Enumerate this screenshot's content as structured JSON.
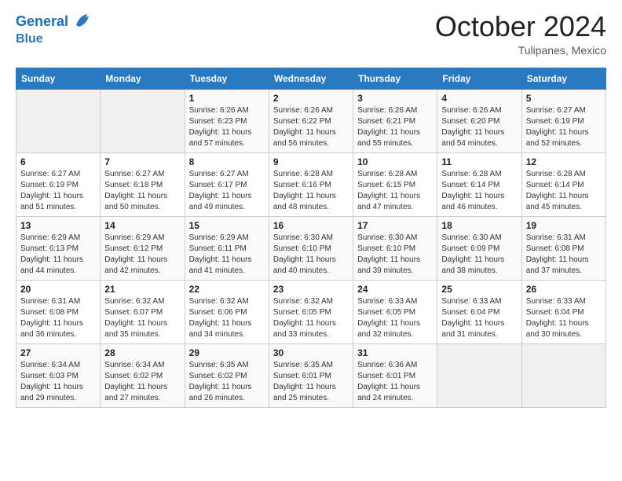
{
  "header": {
    "logo_line1": "General",
    "logo_line2": "Blue",
    "month_title": "October 2024",
    "location": "Tulipanes, Mexico"
  },
  "days_of_week": [
    "Sunday",
    "Monday",
    "Tuesday",
    "Wednesday",
    "Thursday",
    "Friday",
    "Saturday"
  ],
  "weeks": [
    [
      {
        "num": "",
        "empty": true
      },
      {
        "num": "",
        "empty": true
      },
      {
        "num": "1",
        "sunrise": "6:26 AM",
        "sunset": "6:23 PM",
        "daylight": "11 hours and 57 minutes."
      },
      {
        "num": "2",
        "sunrise": "6:26 AM",
        "sunset": "6:22 PM",
        "daylight": "11 hours and 56 minutes."
      },
      {
        "num": "3",
        "sunrise": "6:26 AM",
        "sunset": "6:21 PM",
        "daylight": "11 hours and 55 minutes."
      },
      {
        "num": "4",
        "sunrise": "6:26 AM",
        "sunset": "6:20 PM",
        "daylight": "11 hours and 54 minutes."
      },
      {
        "num": "5",
        "sunrise": "6:27 AM",
        "sunset": "6:19 PM",
        "daylight": "11 hours and 52 minutes."
      }
    ],
    [
      {
        "num": "6",
        "sunrise": "6:27 AM",
        "sunset": "6:19 PM",
        "daylight": "11 hours and 51 minutes."
      },
      {
        "num": "7",
        "sunrise": "6:27 AM",
        "sunset": "6:18 PM",
        "daylight": "11 hours and 50 minutes."
      },
      {
        "num": "8",
        "sunrise": "6:27 AM",
        "sunset": "6:17 PM",
        "daylight": "11 hours and 49 minutes."
      },
      {
        "num": "9",
        "sunrise": "6:28 AM",
        "sunset": "6:16 PM",
        "daylight": "11 hours and 48 minutes."
      },
      {
        "num": "10",
        "sunrise": "6:28 AM",
        "sunset": "6:15 PM",
        "daylight": "11 hours and 47 minutes."
      },
      {
        "num": "11",
        "sunrise": "6:28 AM",
        "sunset": "6:14 PM",
        "daylight": "11 hours and 46 minutes."
      },
      {
        "num": "12",
        "sunrise": "6:28 AM",
        "sunset": "6:14 PM",
        "daylight": "11 hours and 45 minutes."
      }
    ],
    [
      {
        "num": "13",
        "sunrise": "6:29 AM",
        "sunset": "6:13 PM",
        "daylight": "11 hours and 44 minutes."
      },
      {
        "num": "14",
        "sunrise": "6:29 AM",
        "sunset": "6:12 PM",
        "daylight": "11 hours and 42 minutes."
      },
      {
        "num": "15",
        "sunrise": "6:29 AM",
        "sunset": "6:11 PM",
        "daylight": "11 hours and 41 minutes."
      },
      {
        "num": "16",
        "sunrise": "6:30 AM",
        "sunset": "6:10 PM",
        "daylight": "11 hours and 40 minutes."
      },
      {
        "num": "17",
        "sunrise": "6:30 AM",
        "sunset": "6:10 PM",
        "daylight": "11 hours and 39 minutes."
      },
      {
        "num": "18",
        "sunrise": "6:30 AM",
        "sunset": "6:09 PM",
        "daylight": "11 hours and 38 minutes."
      },
      {
        "num": "19",
        "sunrise": "6:31 AM",
        "sunset": "6:08 PM",
        "daylight": "11 hours and 37 minutes."
      }
    ],
    [
      {
        "num": "20",
        "sunrise": "6:31 AM",
        "sunset": "6:08 PM",
        "daylight": "11 hours and 36 minutes."
      },
      {
        "num": "21",
        "sunrise": "6:32 AM",
        "sunset": "6:07 PM",
        "daylight": "11 hours and 35 minutes."
      },
      {
        "num": "22",
        "sunrise": "6:32 AM",
        "sunset": "6:06 PM",
        "daylight": "11 hours and 34 minutes."
      },
      {
        "num": "23",
        "sunrise": "6:32 AM",
        "sunset": "6:05 PM",
        "daylight": "11 hours and 33 minutes."
      },
      {
        "num": "24",
        "sunrise": "6:33 AM",
        "sunset": "6:05 PM",
        "daylight": "11 hours and 32 minutes."
      },
      {
        "num": "25",
        "sunrise": "6:33 AM",
        "sunset": "6:04 PM",
        "daylight": "11 hours and 31 minutes."
      },
      {
        "num": "26",
        "sunrise": "6:33 AM",
        "sunset": "6:04 PM",
        "daylight": "11 hours and 30 minutes."
      }
    ],
    [
      {
        "num": "27",
        "sunrise": "6:34 AM",
        "sunset": "6:03 PM",
        "daylight": "11 hours and 29 minutes."
      },
      {
        "num": "28",
        "sunrise": "6:34 AM",
        "sunset": "6:02 PM",
        "daylight": "11 hours and 27 minutes."
      },
      {
        "num": "29",
        "sunrise": "6:35 AM",
        "sunset": "6:02 PM",
        "daylight": "11 hours and 26 minutes."
      },
      {
        "num": "30",
        "sunrise": "6:35 AM",
        "sunset": "6:01 PM",
        "daylight": "11 hours and 25 minutes."
      },
      {
        "num": "31",
        "sunrise": "6:36 AM",
        "sunset": "6:01 PM",
        "daylight": "11 hours and 24 minutes."
      },
      {
        "num": "",
        "empty": true
      },
      {
        "num": "",
        "empty": true
      }
    ]
  ],
  "labels": {
    "sunrise_label": "Sunrise:",
    "sunset_label": "Sunset:",
    "daylight_label": "Daylight: "
  }
}
